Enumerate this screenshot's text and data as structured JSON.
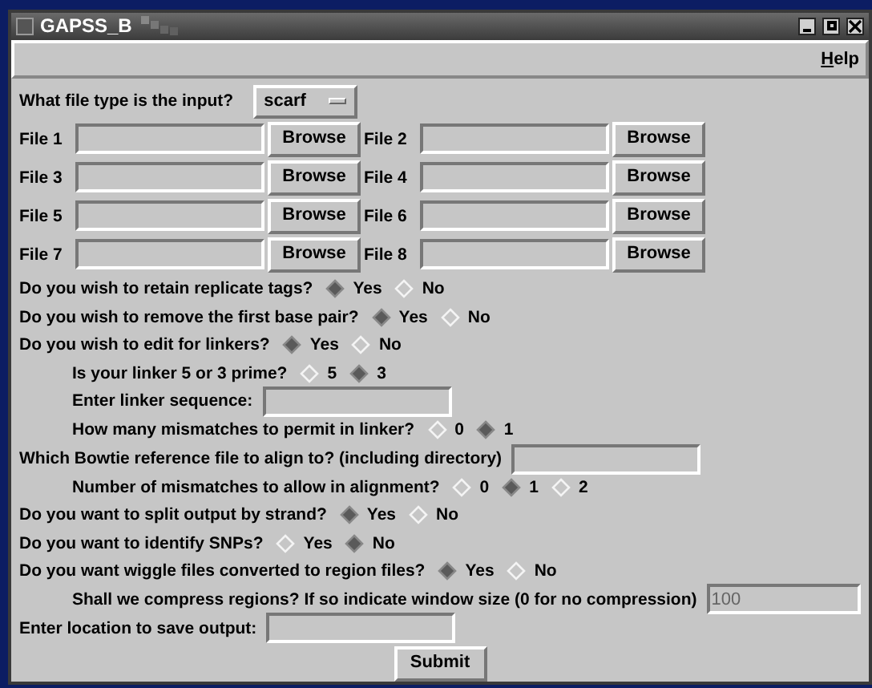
{
  "window": {
    "title": "GAPSS_B"
  },
  "menu": [
    {
      "label": "Help"
    }
  ],
  "file_type": {
    "label": "What file type is the input?",
    "value": "scarf"
  },
  "files": [
    {
      "label": "File 1",
      "button": "Browse"
    },
    {
      "label": "File 2",
      "button": "Browse"
    },
    {
      "label": "File 3",
      "button": "Browse"
    },
    {
      "label": "File 4",
      "button": "Browse"
    },
    {
      "label": "File 5",
      "button": "Browse"
    },
    {
      "label": "File 6",
      "button": "Browse"
    },
    {
      "label": "File 7",
      "button": "Browse"
    },
    {
      "label": "File 8",
      "button": "Browse"
    }
  ],
  "questions": [
    {
      "kind": "radio",
      "label": "Do you wish to retain replicate tags?",
      "options": [
        {
          "label": "Yes",
          "selected": true
        },
        {
          "label": "No",
          "selected": false
        }
      ]
    },
    {
      "kind": "radio",
      "label": "Do you wish to remove the first base pair?",
      "options": [
        {
          "label": "Yes",
          "selected": true
        },
        {
          "label": "No",
          "selected": false
        }
      ]
    },
    {
      "kind": "radio",
      "label": "Do you wish to edit for linkers?",
      "options": [
        {
          "label": "Yes",
          "selected": true
        },
        {
          "label": "No",
          "selected": false
        }
      ],
      "children": [
        {
          "kind": "radio",
          "label": "Is your linker 5 or 3 prime?",
          "options": [
            {
              "label": "5",
              "selected": false
            },
            {
              "label": "3",
              "selected": true
            }
          ]
        },
        {
          "kind": "entry",
          "label": "Enter linker sequence:"
        },
        {
          "kind": "radio",
          "label": "How many mismatches to permit in linker?",
          "options": [
            {
              "label": "0",
              "selected": false
            },
            {
              "label": "1",
              "selected": true
            }
          ]
        }
      ]
    },
    {
      "kind": "entry",
      "label": "Which Bowtie reference file to align to? (including directory)",
      "children": [
        {
          "kind": "radio",
          "label": "Number of mismatches to allow in alignment?",
          "options": [
            {
              "label": "0",
              "selected": false
            },
            {
              "label": "1",
              "selected": true
            },
            {
              "label": "2",
              "selected": false
            }
          ]
        }
      ]
    },
    {
      "kind": "radio",
      "label": "Do you want to split output by strand?",
      "options": [
        {
          "label": "Yes",
          "selected": true
        },
        {
          "label": "No",
          "selected": false
        }
      ]
    },
    {
      "kind": "radio",
      "label": "Do you want to identify SNPs?",
      "options": [
        {
          "label": "Yes",
          "selected": false
        },
        {
          "label": "No",
          "selected": true
        }
      ]
    },
    {
      "kind": "radio",
      "label": "Do you want wiggle files converted to region files?",
      "options": [
        {
          "label": "Yes",
          "selected": true
        },
        {
          "label": "No",
          "selected": false
        }
      ],
      "children": [
        {
          "kind": "entry",
          "label": "Shall we compress regions? If so indicate window size (0 for no compression)",
          "value": "100"
        }
      ]
    },
    {
      "kind": "entry",
      "label": "Enter location to save output:"
    }
  ],
  "submit": {
    "label": "Submit"
  }
}
